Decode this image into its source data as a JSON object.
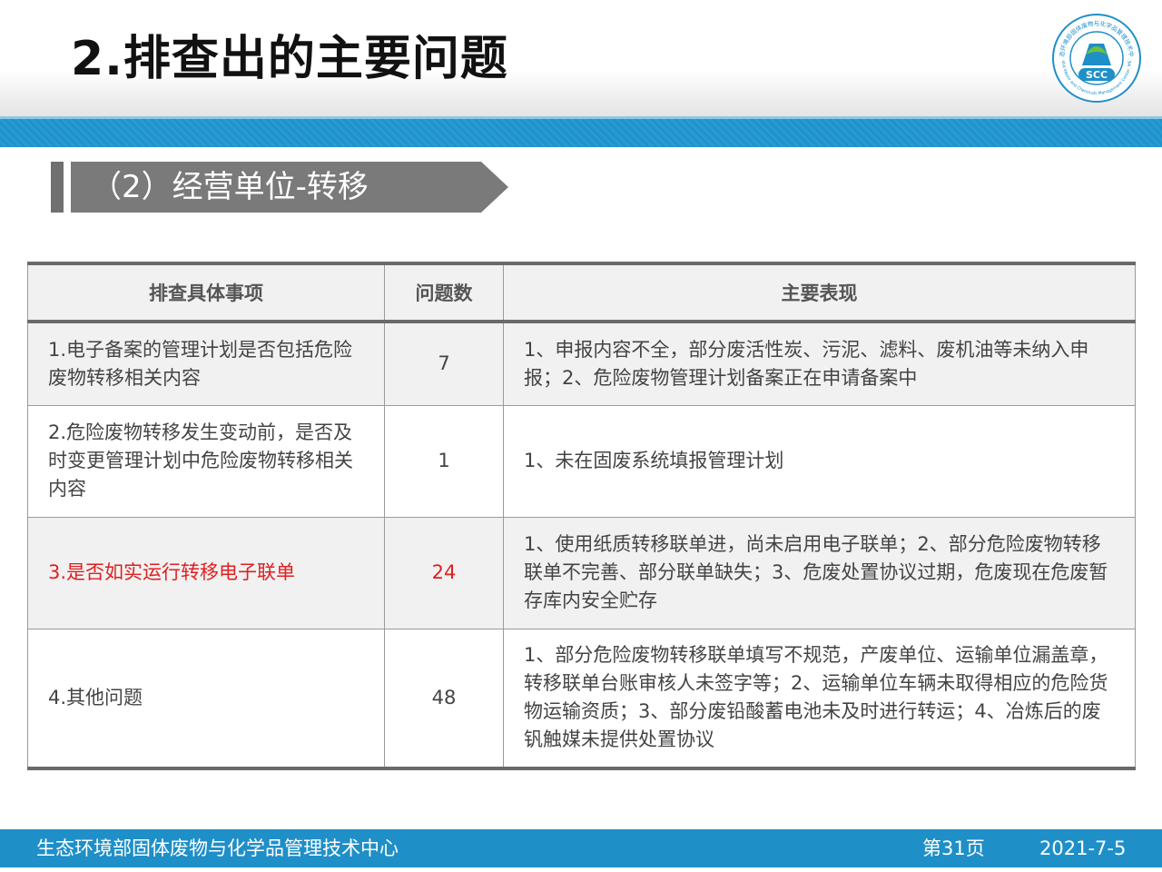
{
  "header": {
    "title": "2.排查出的主要问题"
  },
  "logo": {
    "abbr": "SCC",
    "ring_text_cn": "生态环境部固体废物与化学品管理技术中心",
    "ring_text_en": "Solid Waste and Chemicals Management Center, MEE",
    "colors": {
      "ring": "#1f8fc8",
      "leaf": "#6fbf3a",
      "flask": "#1f8fc8"
    }
  },
  "section": {
    "label": "（2）经营单位-转移"
  },
  "table": {
    "headers": [
      "排查具体事项",
      "问题数",
      "主要表现"
    ],
    "rows": [
      {
        "item": "1.电子备案的管理计划是否包括危险废物转移相关内容",
        "count": "7",
        "detail": "1、申报内容不全，部分废活性炭、污泥、滤料、废机油等未纳入申报；2、危险废物管理计划备案正在申请备案中"
      },
      {
        "item": "2.危险废物转移发生变动前，是否及时变更管理计划中危险废物转移相关内容",
        "count": "1",
        "detail": "1、未在固废系统填报管理计划"
      },
      {
        "item": "3.是否如实运行转移电子联单",
        "count": "24",
        "detail": "1、使用纸质转移联单进，尚未启用电子联单；2、部分危险废物转移联单不完善、部分联单缺失；3、危废处置协议过期，危废现在危废暂存库内安全贮存"
      },
      {
        "item": "4.其他问题",
        "count": "48",
        "detail": "1、部分危险废物转移联单填写不规范，产废单位、运输单位漏盖章，转移联单台账审核人未签字等；2、运输单位车辆未取得相应的危险货物运输资质；3、部分废铅酸蓄电池未及时进行转运；4、冶炼后的废钒触媒未提供处置协议"
      }
    ],
    "highlight_color": "#e02020"
  },
  "footer": {
    "org": "生态环境部固体废物与化学品管理技术中心",
    "page": "第31页",
    "date": "2021-7-5"
  }
}
